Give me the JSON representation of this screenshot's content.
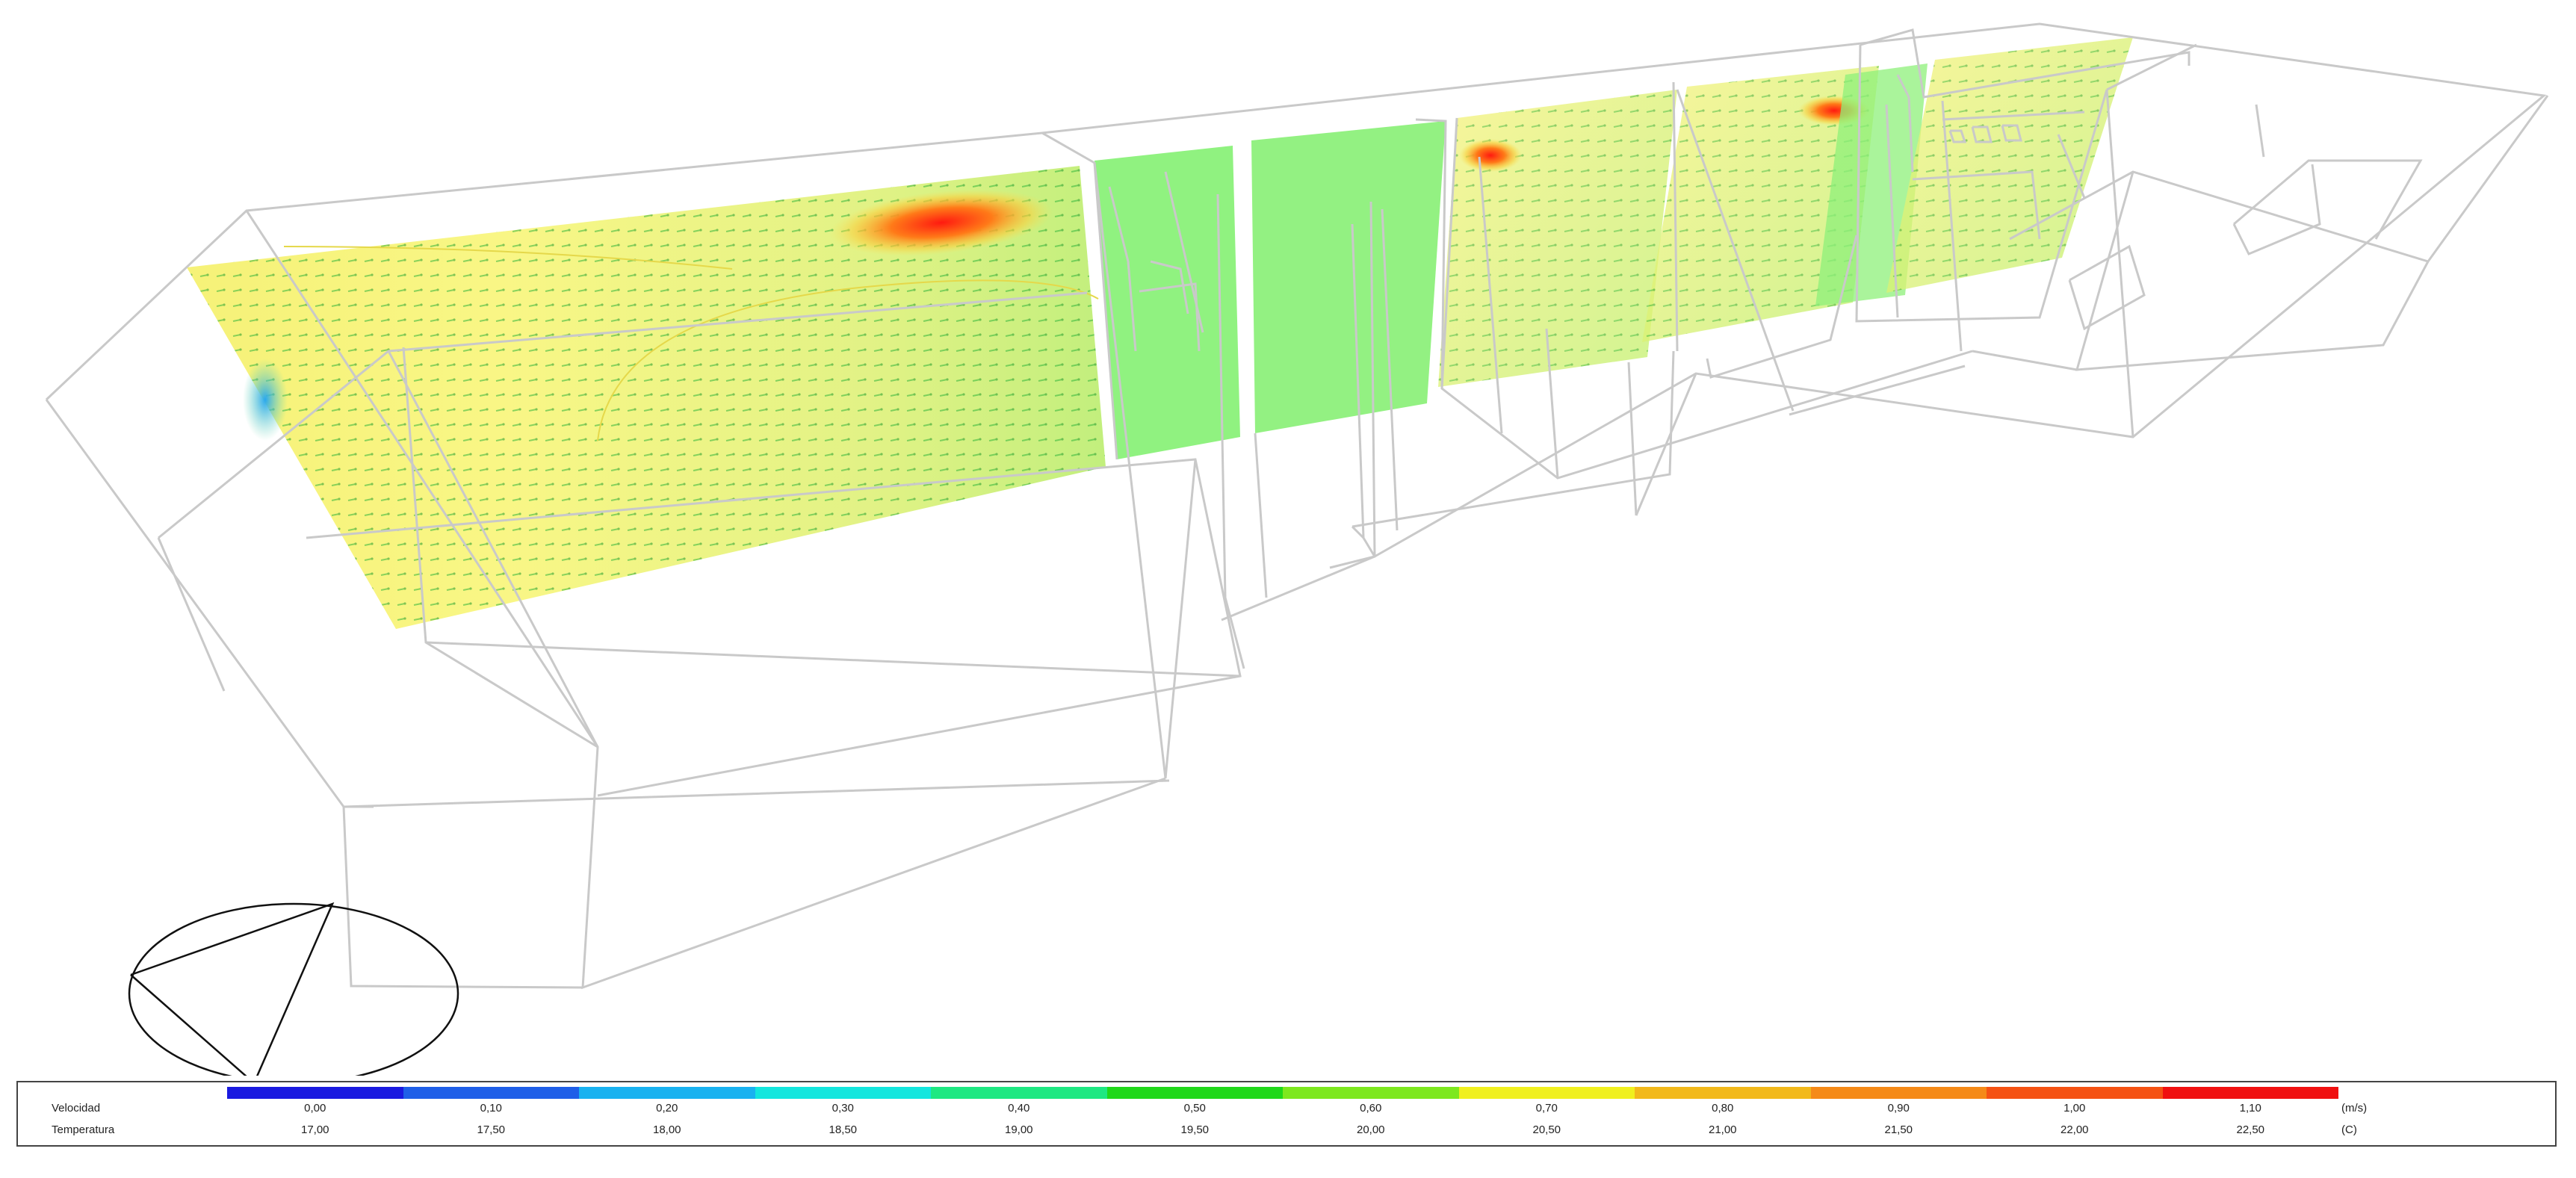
{
  "legend": {
    "row1_label": "Velocidad",
    "row2_label": "Temperatura",
    "row1_unit": "(m/s)",
    "row2_unit": "(C)",
    "colors": [
      "#1a1ae0",
      "#1f5fe8",
      "#19b2f0",
      "#13e6de",
      "#1ee882",
      "#20d81a",
      "#7de81e",
      "#f0f01e",
      "#f2b91b",
      "#f58a18",
      "#f55214",
      "#f01010"
    ],
    "velocidad": [
      "0,00",
      "0,10",
      "0,20",
      "0,30",
      "0,40",
      "0,50",
      "0,60",
      "0,70",
      "0,80",
      "0,90",
      "1,00",
      "1,10"
    ],
    "temperatura": [
      "17,00",
      "17,50",
      "18,00",
      "18,50",
      "19,00",
      "19,50",
      "20,00",
      "20,50",
      "21,00",
      "21,50",
      "22,00",
      "22,50"
    ]
  }
}
